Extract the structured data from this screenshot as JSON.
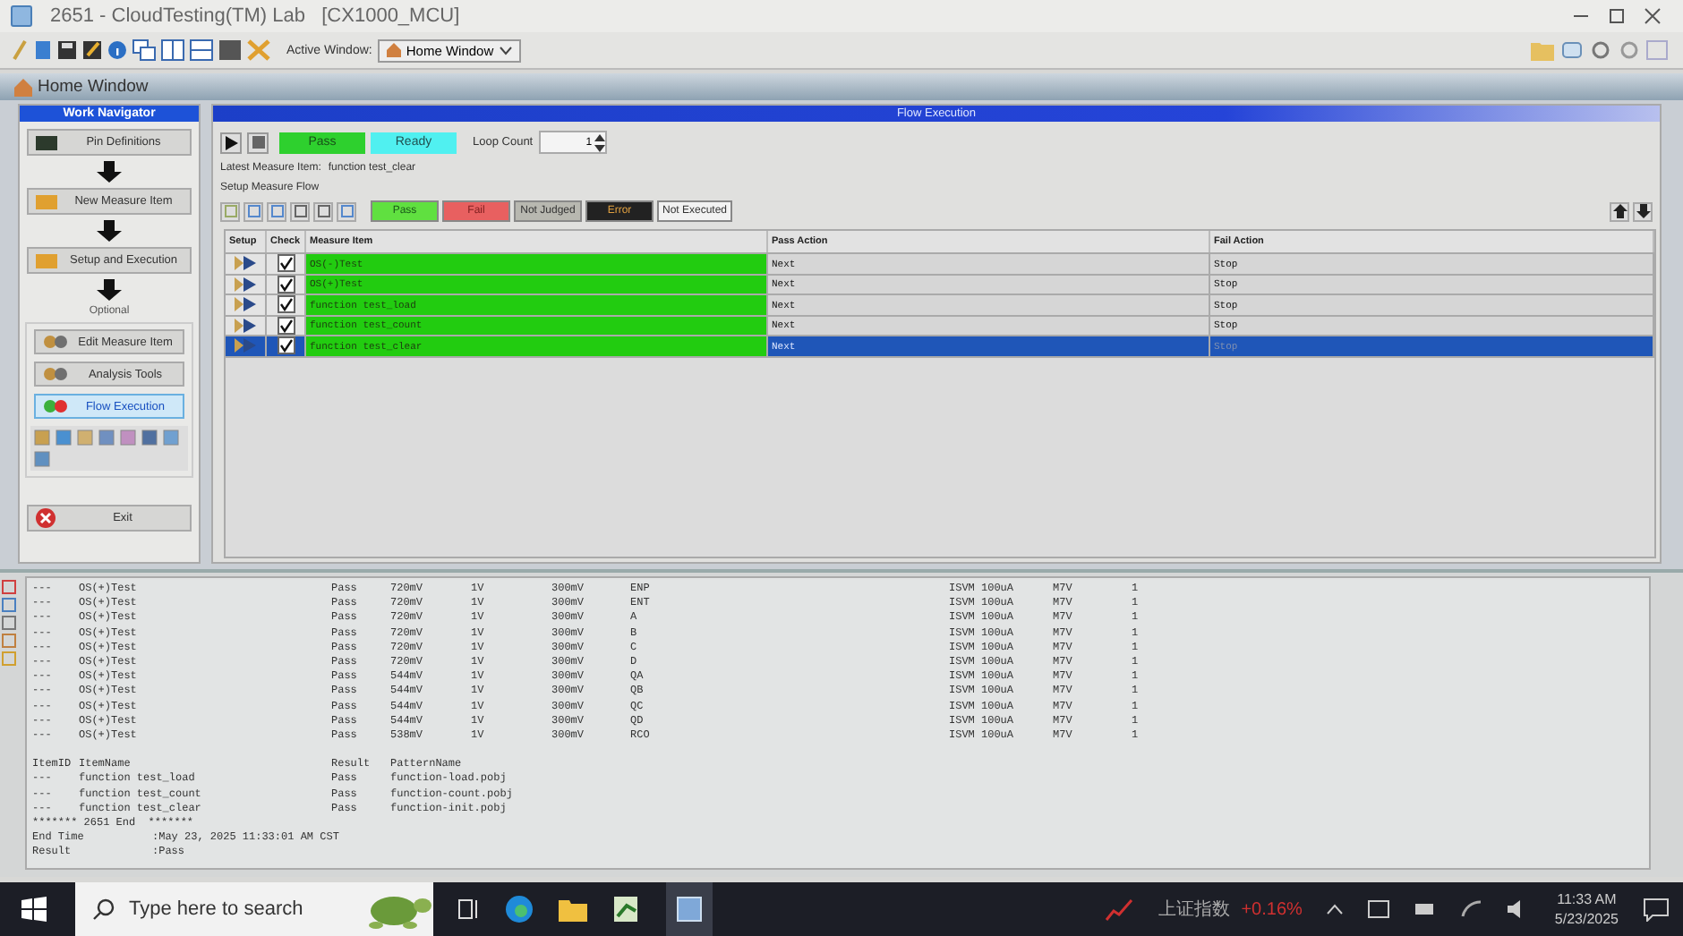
{
  "window": {
    "title": "2651 - CloudTesting(TM) Lab   [CX1000_MCU]"
  },
  "toolbar": {
    "active_window_label": "Active Window:",
    "active_window_value": "Home Window"
  },
  "home_window": {
    "title": "Home Window"
  },
  "navigator": {
    "title": "Work Navigator",
    "steps": [
      {
        "label": "Pin Definitions",
        "selected": false
      },
      {
        "label": "New Measure Item",
        "selected": false
      },
      {
        "label": "Setup and Execution",
        "selected": false
      }
    ],
    "optional_label": "Optional",
    "optional_items": [
      {
        "label": "Edit Measure Item",
        "selected": false
      },
      {
        "label": "Analysis Tools",
        "selected": false
      },
      {
        "label": "Flow Execution",
        "selected": true
      }
    ],
    "exit": "Exit"
  },
  "flow": {
    "title": "Flow Execution",
    "pass_indicator": "Pass",
    "ready_indicator": "Ready",
    "loop_count_label": "Loop Count",
    "loop_count_value": "1",
    "latest_label": "Latest Measure Item:",
    "latest_value": "function test_clear",
    "setup_label": "Setup Measure Flow",
    "legend": [
      {
        "label": "Pass",
        "kind": "pass"
      },
      {
        "label": "Fail",
        "kind": "fail"
      },
      {
        "label": "Not Judged",
        "kind": "notjudged"
      },
      {
        "label": "Error",
        "kind": "error"
      },
      {
        "label": "Not Executed",
        "kind": "notexecuted"
      }
    ],
    "columns": [
      "Setup",
      "Check",
      "Measure Item",
      "Pass Action",
      "Fail Action"
    ],
    "rows": [
      {
        "item": "OS(-)Test",
        "pass_action": "Next",
        "fail_action": "Stop",
        "checked": true,
        "kind": "pass",
        "selected": false
      },
      {
        "item": "OS(+)Test",
        "pass_action": "Next",
        "fail_action": "Stop",
        "checked": true,
        "kind": "pass",
        "selected": false
      },
      {
        "item": "function test_load",
        "pass_action": "Next",
        "fail_action": "Stop",
        "checked": true,
        "kind": "pass",
        "selected": false
      },
      {
        "item": "function test_count",
        "pass_action": "Next",
        "fail_action": "Stop",
        "checked": true,
        "kind": "pass",
        "selected": false
      },
      {
        "item": "function test_clear",
        "pass_action": "Next",
        "fail_action": "Stop",
        "checked": true,
        "kind": "pass",
        "selected": true
      }
    ]
  },
  "log": {
    "rows": [
      [
        "---",
        "OS(+)Test",
        "Pass",
        "720mV",
        "1V",
        "300mV",
        "ENP",
        "ISVM 100uA",
        "M7V",
        "1"
      ],
      [
        "---",
        "OS(+)Test",
        "Pass",
        "720mV",
        "1V",
        "300mV",
        "ENT",
        "ISVM 100uA",
        "M7V",
        "1"
      ],
      [
        "---",
        "OS(+)Test",
        "Pass",
        "720mV",
        "1V",
        "300mV",
        "A",
        "ISVM 100uA",
        "M7V",
        "1"
      ],
      [
        "---",
        "OS(+)Test",
        "Pass",
        "720mV",
        "1V",
        "300mV",
        "B",
        "ISVM 100uA",
        "M7V",
        "1"
      ],
      [
        "---",
        "OS(+)Test",
        "Pass",
        "720mV",
        "1V",
        "300mV",
        "C",
        "ISVM 100uA",
        "M7V",
        "1"
      ],
      [
        "---",
        "OS(+)Test",
        "Pass",
        "720mV",
        "1V",
        "300mV",
        "D",
        "ISVM 100uA",
        "M7V",
        "1"
      ],
      [
        "---",
        "OS(+)Test",
        "Pass",
        "544mV",
        "1V",
        "300mV",
        "QA",
        "ISVM 100uA",
        "M7V",
        "1"
      ],
      [
        "---",
        "OS(+)Test",
        "Pass",
        "544mV",
        "1V",
        "300mV",
        "QB",
        "ISVM 100uA",
        "M7V",
        "1"
      ],
      [
        "---",
        "OS(+)Test",
        "Pass",
        "544mV",
        "1V",
        "300mV",
        "QC",
        "ISVM 100uA",
        "M7V",
        "1"
      ],
      [
        "---",
        "OS(+)Test",
        "Pass",
        "544mV",
        "1V",
        "300mV",
        "QD",
        "ISVM 100uA",
        "M7V",
        "1"
      ],
      [
        "---",
        "OS(+)Test",
        "Pass",
        "538mV",
        "1V",
        "300mV",
        "RCO",
        "ISVM 100uA",
        "M7V",
        "1"
      ]
    ],
    "summary_header": [
      "ItemID",
      "ItemName",
      "Result",
      "PatternName"
    ],
    "summary_rows": [
      [
        "---",
        "function test_load",
        "Pass",
        "function-load.pobj"
      ],
      [
        "---",
        "function test_count",
        "Pass",
        "function-count.pobj"
      ],
      [
        "---",
        "function test_clear",
        "Pass",
        "function-init.pobj"
      ]
    ],
    "end_marker": "******* 2651 End  *******",
    "footer": [
      [
        "End Time",
        ":May 23, 2025 11:33:01 AM CST"
      ],
      [
        "Result",
        ":Pass"
      ]
    ]
  },
  "taskbar": {
    "search_placeholder": "Type here to search",
    "stock_name": "上证指数",
    "stock_change": "+0.16%",
    "time": "11:33 AM",
    "date": "5/23/2025"
  }
}
